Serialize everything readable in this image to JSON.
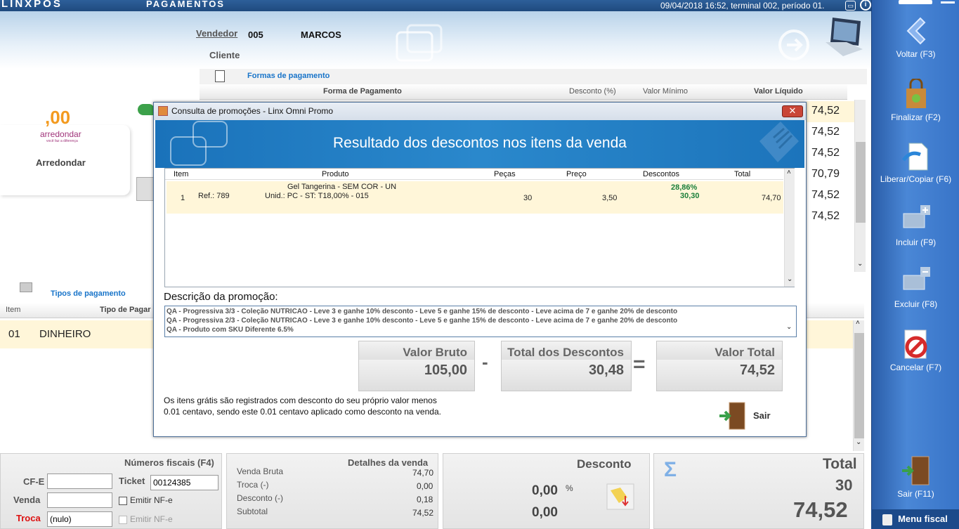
{
  "topbar": {
    "brand": "LINXPOS",
    "page": "PAGAMENTOS",
    "status": "09/04/2018 16:52, terminal 002, período 01."
  },
  "header": {
    "vendedor_label": "Vendedor",
    "vendedor_code": "005",
    "vendedor_name": "MARCOS",
    "cliente_label": "Cliente"
  },
  "formas": {
    "title": "Formas de pagamento",
    "col_forma": "Forma de Pagamento",
    "col_desconto": "Desconto (%)",
    "col_minimo": "Valor Mínimo",
    "col_liquido": "Valor Líquido",
    "values": [
      "74,52",
      "74,52",
      "74,52",
      "70,79",
      "74,52",
      "74,52"
    ]
  },
  "arredondar": {
    "amount": ",00",
    "brand": "arredondar",
    "tagline": "você faz a diferença",
    "label": "Arredondar"
  },
  "tipos": {
    "title": "Tipos de pagamento",
    "col_item": "Item",
    "col_tipo": "Tipo de Pagar",
    "row_item": "01",
    "row_tipo": "DINHEIRO"
  },
  "sidebar": {
    "voltar": "Voltar (F3)",
    "finalizar": "Finalizar (F2)",
    "liberar": "Liberar/Copiar (F6)",
    "incluir": "Incluir (F9)",
    "excluir": "Excluir (F8)",
    "cancelar": "Cancelar (F7)",
    "sair": "Sair (F11)",
    "menu": "Menu fiscal"
  },
  "dialog": {
    "title": "Consulta de promoções - Linx Omni Promo",
    "banner": "Resultado dos descontos nos itens da venda",
    "cols": {
      "item": "Item",
      "produto": "Produto",
      "pecas": "Peças",
      "preco": "Preço",
      "descontos": "Descontos",
      "total": "Total"
    },
    "row": {
      "item": "1",
      "ref": "Ref.: 789",
      "produto": "Gel Tangerina - SEM COR - UN",
      "detalhe": "015 - Unid.: PC - ST: T18,00%",
      "pecas": "30",
      "preco": "3,50",
      "desc_pct": "28,86%",
      "desc_val": "30,30",
      "total": "74,70"
    },
    "descricao_label": "Descrição da promoção:",
    "descricoes": [
      "QA - Progressiva 3/3 - Coleção NUTRICAO - Leve 3 e ganhe 10% desconto - Leve 5 e ganhe 15% de desconto - Leve acima de 7 e ganhe 20% de desconto",
      "QA - Progressiva 2/3 - Coleção NUTRICAO - Leve 3 e ganhe 10% desconto - Leve 5 e ganhe 15% de desconto - Leve acima de 7 e ganhe 20% de desconto",
      "QA - Produto com SKU Diferente 6.5%"
    ],
    "valor_bruto_label": "Valor Bruto",
    "valor_bruto": "105,00",
    "minus": "-",
    "total_desc_label": "Total dos Descontos",
    "total_desc": "30,48",
    "equals": "=",
    "valor_total_label": "Valor Total",
    "valor_total": "74,52",
    "nota": "Os itens grátis são registrados com desconto do seu próprio valor menos 0.01 centavo, sendo este 0.01 centavo aplicado como desconto na venda.",
    "sair": "Sair",
    "close": "✕"
  },
  "bottom": {
    "fiscais_title": "Números fiscais (F4)",
    "cfe_label": "CF-E",
    "ticket_label": "Ticket",
    "ticket_value": "00124385",
    "venda_label": "Venda",
    "emitir1": "Emitir NF-e",
    "troca_label": "Troca",
    "troca_value": "(nulo)",
    "emitir2": "Emitir NF-e",
    "detalhes_title": "Detalhes da venda",
    "venda_bruta_label": "Venda Bruta",
    "venda_bruta": "74,70",
    "troca_l": "Troca (-)",
    "troca_v": "0,00",
    "desconto_l": "Desconto (-)",
    "desconto_v": "0,18",
    "subtotal_l": "Subtotal",
    "subtotal_v": "74,52",
    "desconto_title": "Desconto",
    "desc_pct": "0,00",
    "pct_sign": "%",
    "desc_val": "0,00",
    "total_title": "Total",
    "total_qty": "30",
    "total_value": "74,52",
    "sigma": "Σ"
  }
}
